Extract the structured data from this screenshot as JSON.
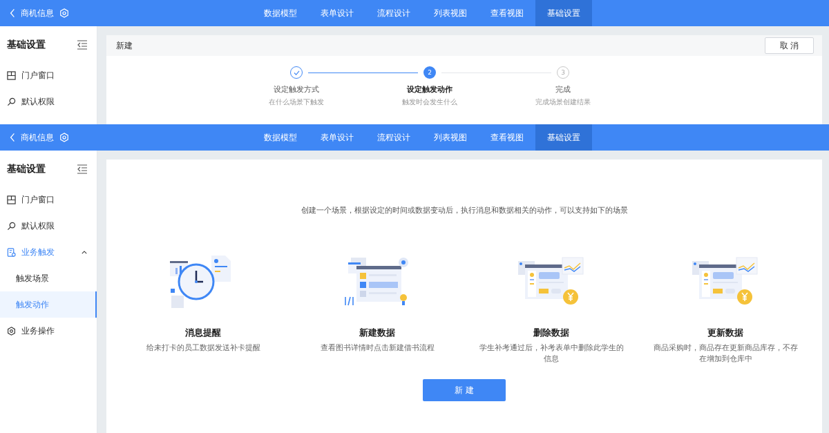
{
  "screens": [
    {
      "header": {
        "title": "商机信息",
        "tabs": [
          {
            "label": "数据模型",
            "selected": false
          },
          {
            "label": "表单设计",
            "selected": false
          },
          {
            "label": "流程设计",
            "selected": false
          },
          {
            "label": "列表视图",
            "selected": false
          },
          {
            "label": "查看视图",
            "selected": false
          },
          {
            "label": "基础设置",
            "selected": true
          }
        ]
      },
      "sidebar": {
        "title": "基础设置",
        "items": [
          {
            "label": "门户窗口",
            "selected": false
          },
          {
            "label": "默认权限",
            "selected": false
          }
        ]
      },
      "content": {
        "kind": "wizard",
        "title": "新建",
        "cancel_button": "取 消",
        "steps": [
          {
            "title": "设定触发方式",
            "subtitle": "在什么场景下触发",
            "completed": true,
            "selected": false
          },
          {
            "number": "2",
            "title": "设定触发动作",
            "subtitle": "触发时会发生什么",
            "completed": false,
            "selected": true
          },
          {
            "number": "3",
            "title": "完成",
            "subtitle": "完成场景创建结果",
            "completed": false,
            "selected": false
          }
        ]
      }
    },
    {
      "header": {
        "title": "商机信息",
        "tabs": [
          {
            "label": "数据模型",
            "selected": false
          },
          {
            "label": "表单设计",
            "selected": false
          },
          {
            "label": "流程设计",
            "selected": false
          },
          {
            "label": "列表视图",
            "selected": false
          },
          {
            "label": "查看视图",
            "selected": false
          },
          {
            "label": "基础设置",
            "selected": true
          }
        ]
      },
      "sidebar": {
        "title": "基础设置",
        "items": [
          {
            "label": "门户窗口",
            "selected": false
          },
          {
            "label": "默认权限",
            "selected": false
          },
          {
            "label": "业务触发",
            "selected": true,
            "expanded": true,
            "children": [
              {
                "label": "触发场景",
                "selected": false
              },
              {
                "label": "触发动作",
                "selected": true
              }
            ]
          },
          {
            "label": "业务操作",
            "selected": false
          }
        ]
      },
      "content": {
        "kind": "scenarios",
        "intro": "创建一个场景，根据设定的时间或数据变动后，执行消息和数据相关的动作，可以支持如下的场景",
        "scenarios": [
          {
            "kind": "clock",
            "title": "消息提醒",
            "description": "给未打卡的员工数据发送补卡提醒"
          },
          {
            "kind": "form",
            "title": "新建数据",
            "description": "查看图书详情时点击新建借书流程"
          },
          {
            "kind": "dashboard",
            "title": "删除数据",
            "description": "学生补考通过后，补考表单中删除此学生的信息"
          },
          {
            "kind": "dashboard",
            "title": "更新数据",
            "description": "商品采购时，商品存在更新商品库存，不存在增加到仓库中"
          }
        ],
        "create_button": "新 建"
      }
    }
  ]
}
